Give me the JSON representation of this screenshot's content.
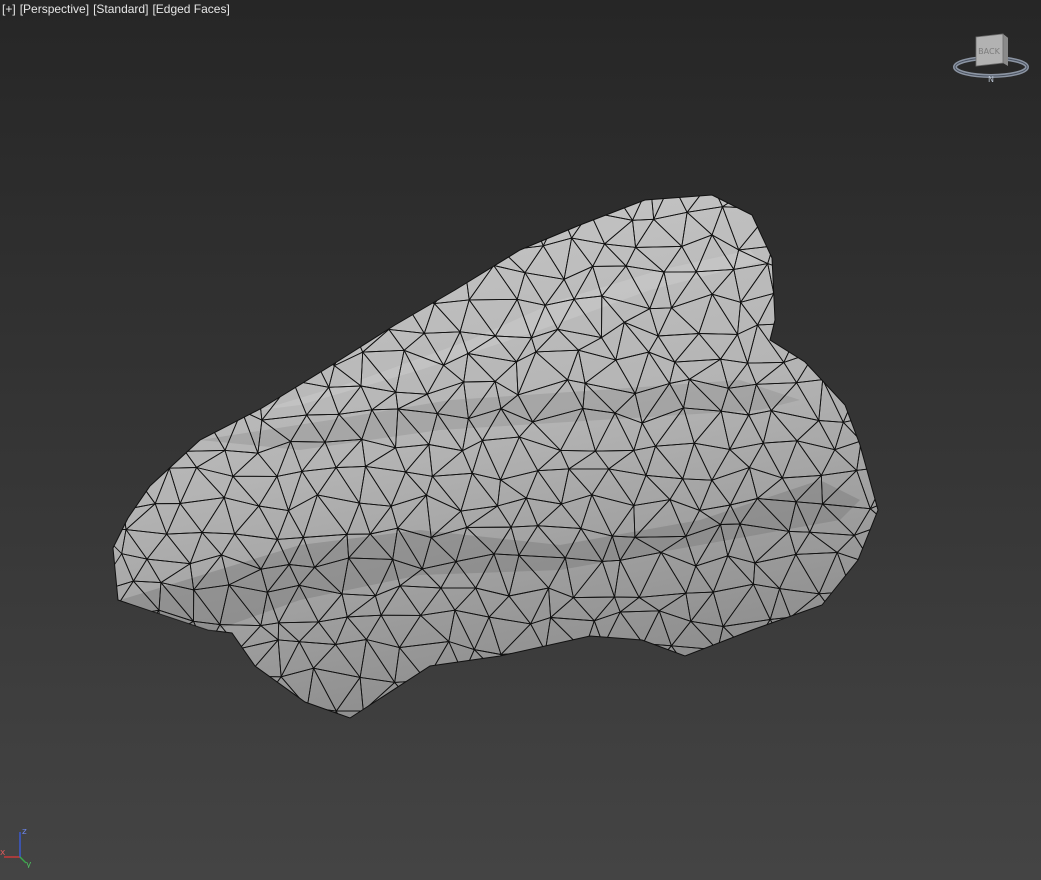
{
  "viewport": {
    "labels": [
      "[+]",
      "[Perspective]",
      "[Standard]",
      "[Edged Faces]"
    ]
  },
  "viewcube": {
    "face_label": "BACK",
    "compass_label": "N"
  },
  "axis_tripod": {
    "z_label": "z",
    "x_label": "x",
    "y_label": "y",
    "colors": {
      "x": "#d23a3a",
      "y": "#3aa84a",
      "z": "#3a5bd8"
    }
  },
  "colors": {
    "bg_top": "#262626",
    "bg_bottom": "#444444",
    "mesh_fill": "#bdbdbd",
    "mesh_edge": "#111111"
  }
}
